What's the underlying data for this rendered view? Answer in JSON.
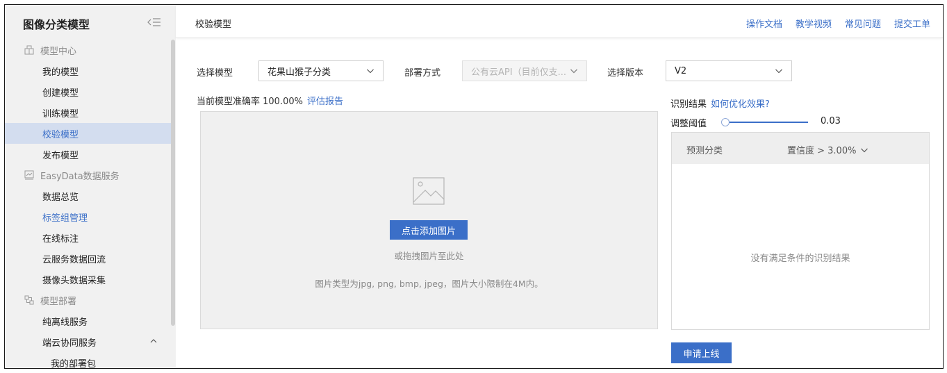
{
  "sidebar": {
    "title": "图像分类模型",
    "groups": [
      {
        "label": "模型中心",
        "icon": "model-center-icon"
      },
      {
        "label": "EasyData数据服务",
        "icon": "chart-line-icon"
      },
      {
        "label": "模型部署",
        "icon": "deploy-icon"
      }
    ],
    "items": [
      {
        "label": "我的模型"
      },
      {
        "label": "创建模型"
      },
      {
        "label": "训练模型"
      },
      {
        "label": "校验模型",
        "active": true
      },
      {
        "label": "发布模型"
      },
      {
        "label": "数据总览"
      },
      {
        "label": "标签组管理"
      },
      {
        "label": "在线标注"
      },
      {
        "label": "云服务数据回流"
      },
      {
        "label": "摄像头数据采集"
      },
      {
        "label": "纯离线服务"
      },
      {
        "label": "端云协同服务",
        "expanded": true
      },
      {
        "label": "我的部署包"
      }
    ]
  },
  "header": {
    "page_title": "校验模型",
    "links": [
      "操作文档",
      "教学视频",
      "常见问题",
      "提交工单"
    ]
  },
  "form": {
    "model_label": "选择模型",
    "model_value": "花果山猴子分类",
    "deploy_label": "部署方式",
    "deploy_value": "公有云API（目前仅支...",
    "version_label": "选择版本",
    "version_value": "V2"
  },
  "accuracy": {
    "text": "当前模型准确率 100.00%",
    "report_link": "评估报告"
  },
  "upload": {
    "button_label": "点击添加图片",
    "drag_hint": "或拖拽图片至此处",
    "type_hint": "图片类型为jpg, png, bmp, jpeg，图片大小限制在4M内。"
  },
  "result": {
    "label": "识别结果",
    "optimize_link": "如何优化效果?",
    "threshold_label": "调整阈值",
    "threshold_value": "0.03",
    "col_category": "预测分类",
    "col_confidence": "置信度 > 3.00%",
    "empty_text": "没有满足条件的识别结果",
    "apply_button": "申请上线"
  },
  "colors": {
    "accent": "#3b6fc8",
    "sidebar_bg": "#f1f1f1",
    "active_bg": "#d3ddef"
  }
}
